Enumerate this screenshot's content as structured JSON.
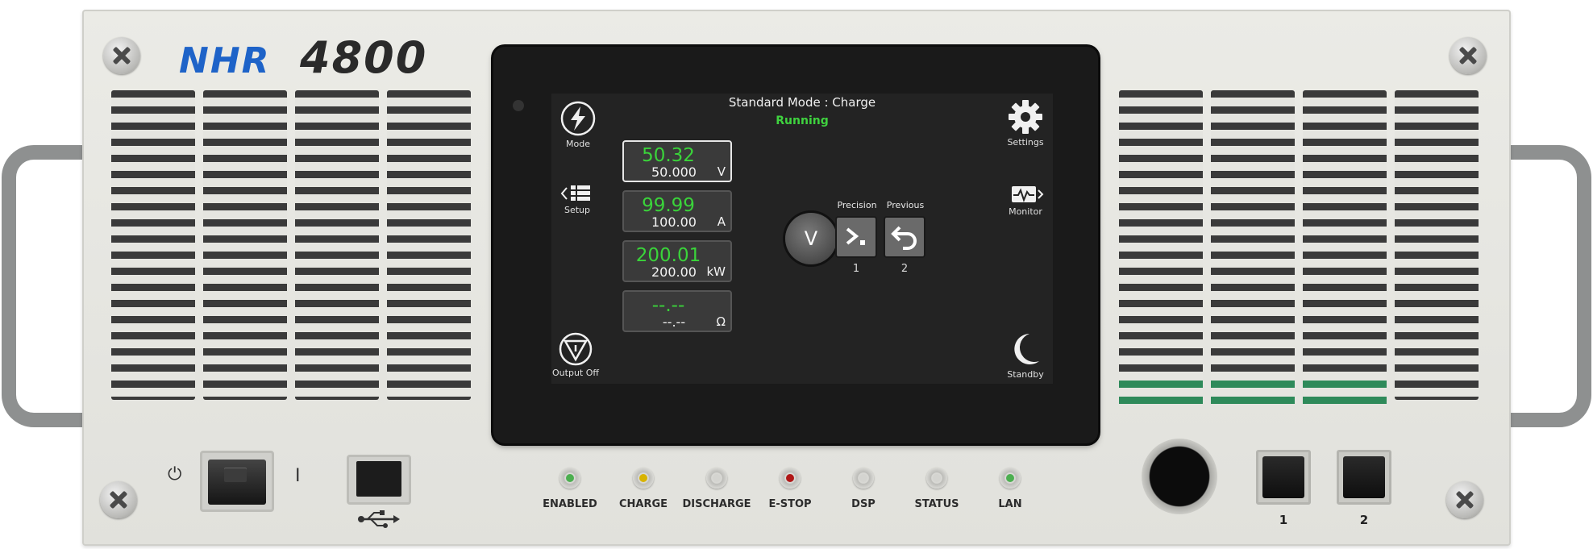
{
  "device": {
    "brand": "NHR",
    "model": "4800"
  },
  "screen": {
    "mode_title": "Standard  Mode : Charge",
    "status": "Running",
    "buttons": {
      "mode": "Mode",
      "settings": "Settings",
      "setup": "Setup",
      "monitor": "Monitor",
      "output_off": "Output Off",
      "standby": "Standby"
    },
    "readouts": [
      {
        "measured": "50.32",
        "setpoint": "50.000",
        "unit": "V"
      },
      {
        "measured": "99.99",
        "setpoint": "100.00",
        "unit": "A"
      },
      {
        "measured": "200.01",
        "setpoint": "200.00",
        "unit": "kW"
      },
      {
        "measured": "--.--",
        "setpoint": "--.--",
        "unit": "Ω"
      }
    ],
    "v_button": "V",
    "precision": {
      "label": "Precision",
      "number": "1"
    },
    "previous": {
      "label": "Previous",
      "number": "2"
    }
  },
  "leds": [
    {
      "label": "ENABLED",
      "color": "#4caf50"
    },
    {
      "label": "CHARGE",
      "color": "#d8b300"
    },
    {
      "label": "DISCHARGE",
      "color": "#d4d4d0"
    },
    {
      "label": "E-STOP",
      "color": "#b01818"
    },
    {
      "label": "DSP",
      "color": "#d4d4d0"
    },
    {
      "label": "STATUS",
      "color": "#d4d4d0"
    },
    {
      "label": "LAN",
      "color": "#4caf50"
    }
  ],
  "keys": {
    "key1": "1",
    "key2": "2"
  },
  "power_switch": {
    "off_symbol": "⏻",
    "on_symbol": "I"
  },
  "icons": [
    "mode-bolt-icon",
    "gear-icon",
    "setup-list-icon",
    "monitor-wave-icon",
    "output-off-icon",
    "moon-icon",
    "precision-prompt-icon",
    "undo-arrow-icon",
    "usb-icon"
  ]
}
